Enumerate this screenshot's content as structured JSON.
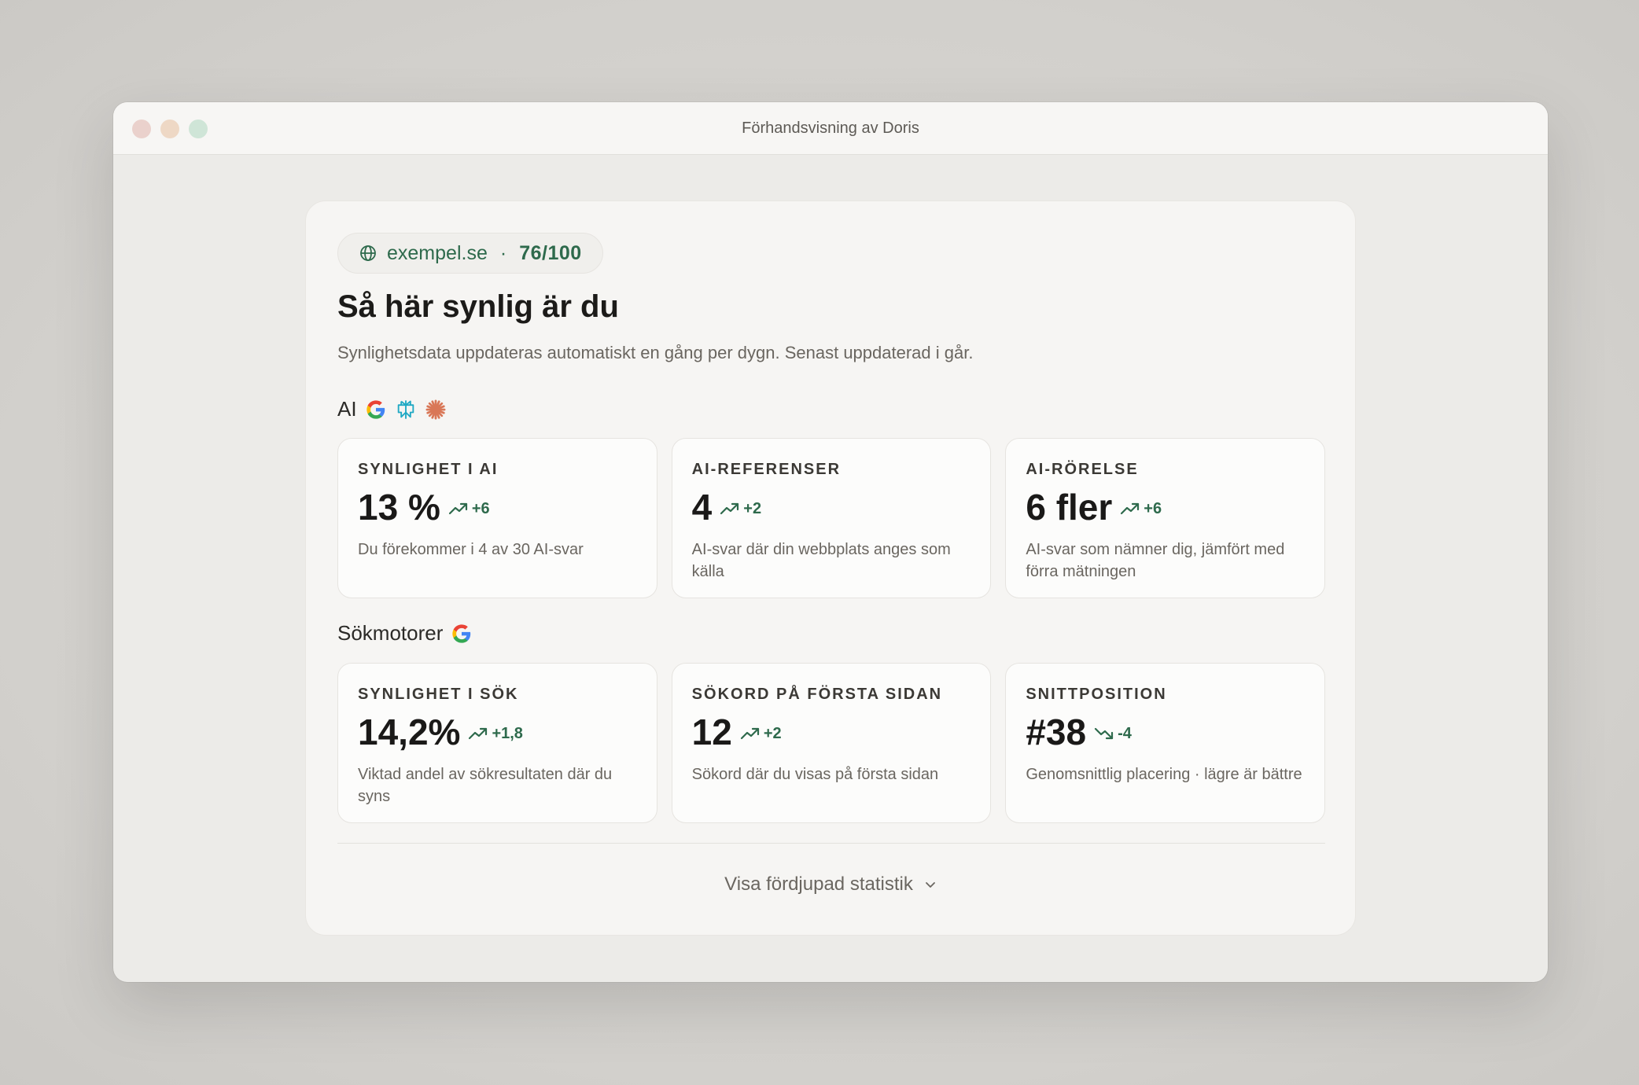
{
  "window": {
    "title": "Förhandsvisning av Doris"
  },
  "site": {
    "domain": "exempel.se",
    "separator": "·",
    "score": "76/100",
    "icon": "globe-icon"
  },
  "header": {
    "title": "Så här synlig är du",
    "subtitle": "Synlighetsdata uppdateras automatiskt en gång per dygn. Senast uppdaterad i går."
  },
  "sections": {
    "ai": {
      "title": "AI",
      "icons": [
        "google-g-icon",
        "perplexity-icon",
        "claude-icon"
      ],
      "metrics": [
        {
          "label": "SYNLIGHET I AI",
          "value": "13 %",
          "delta": "+6",
          "trend": "up",
          "desc": "Du förekommer i 4 av 30 AI-svar"
        },
        {
          "label": "AI-REFERENSER",
          "value": "4",
          "delta": "+2",
          "trend": "up",
          "desc": "AI-svar där din webbplats anges som källa"
        },
        {
          "label": "AI-RÖRELSE",
          "value": "6 fler",
          "delta": "+6",
          "trend": "up",
          "desc": "AI-svar som nämner dig, jämfört med förra mätningen"
        }
      ]
    },
    "search": {
      "title": "Sökmotorer",
      "icons": [
        "google-g-icon"
      ],
      "metrics": [
        {
          "label": "SYNLIGHET I SÖK",
          "value": "14,2%",
          "delta": "+1,8",
          "trend": "up",
          "desc": "Viktad andel av sökresultaten där du syns"
        },
        {
          "label": "SÖKORD PÅ FÖRSTA SIDAN",
          "value": "12",
          "delta": "+2",
          "trend": "up",
          "desc": "Sökord där du visas på första sidan"
        },
        {
          "label": "SNITTPOSITION",
          "value": "#38",
          "delta": "-4",
          "trend": "down",
          "desc": "Genomsnittlig placering · lägre är bättre"
        }
      ]
    }
  },
  "footer": {
    "more_label": "Visa fördjupad statistik",
    "icon": "chevron-down-icon"
  },
  "colors": {
    "accent": "#2e6a4c",
    "claude": "#d97757",
    "perplexity": "#20a9c4"
  }
}
